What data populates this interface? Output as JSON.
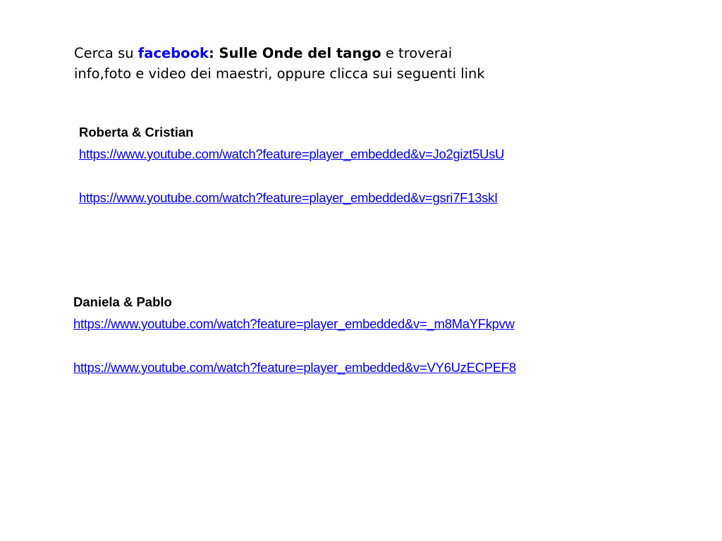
{
  "intro": {
    "prefix": "Cerca su ",
    "facebook": "facebook",
    "page_name": ": Sulle Onde del tango",
    "suffix": " e troverai",
    "line2": "info,foto e video dei maestri, oppure clicca sui seguenti link"
  },
  "groups": [
    {
      "heading": "Roberta & Cristian",
      "links": [
        "https://www.youtube.com/watch?feature=player_embedded&v=Jo2gizt5UsU",
        "https://www.youtube.com/watch?feature=player_embedded&v=gsri7F13skI"
      ]
    },
    {
      "heading": "Daniela & Pablo",
      "links": [
        "https://www.youtube.com/watch?feature=player_embedded&v=_m8MaYFkpvw",
        "https://www.youtube.com/watch?feature=player_embedded&v=VY6UzECPEF8"
      ]
    }
  ],
  "colors": {
    "link": "#0000ee",
    "text": "#000000",
    "background": "#ffffff"
  }
}
